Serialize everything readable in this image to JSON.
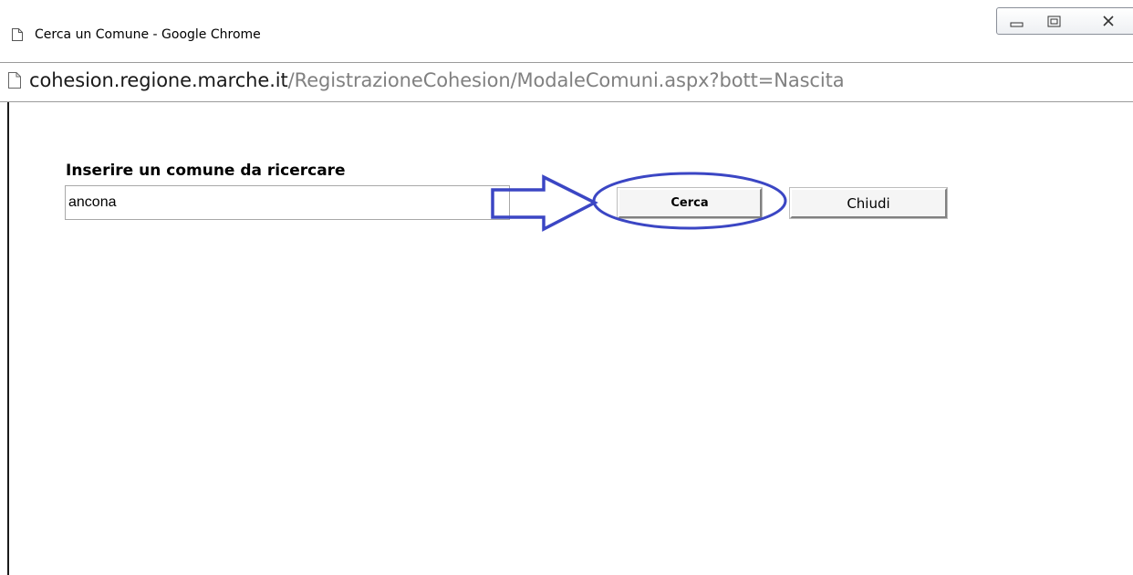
{
  "window": {
    "title": "Cerca un Comune - Google Chrome",
    "controls": {
      "minimize": "minimize-icon",
      "maximize": "maximize-icon",
      "close": "close-icon"
    }
  },
  "address_bar": {
    "host": "cohesion.regione.marche.it",
    "path": "/RegistrazioneCohesion/ModaleComuni.aspx?bott=Nascita",
    "icon": "page-icon"
  },
  "search": {
    "label": "Inserire un comune da ricercare",
    "value": "ancona"
  },
  "buttons": {
    "search_label": "Cerca",
    "close_label": "Chiudi"
  },
  "annotation": {
    "color": "#3b46c4",
    "arrow_icon": "arrow-right-icon",
    "highlight": "ellipse"
  }
}
